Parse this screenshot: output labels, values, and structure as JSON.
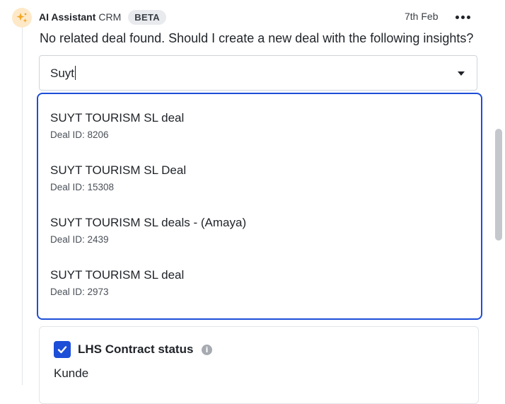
{
  "header": {
    "sender": "AI Assistant",
    "sender_suffix": "CRM",
    "badge": "BETA",
    "date": "7th Feb"
  },
  "message": "No related deal found. Should I create a new deal with the following insights?",
  "deal_select": {
    "value": "Suyt"
  },
  "deal_options": [
    {
      "title": "SUYT TOURISM SL deal",
      "subtitle": "Deal ID: 8206"
    },
    {
      "title": "SUYT TOURISM SL Deal",
      "subtitle": "Deal ID: 15308"
    },
    {
      "title": "SUYT TOURISM SL deals - (Amaya)",
      "subtitle": "Deal ID: 2439"
    },
    {
      "title": "SUYT TOURISM SL deal",
      "subtitle": "Deal ID: 2973"
    }
  ],
  "insight_card": {
    "checked": true,
    "label": "LHS Contract status",
    "value": "Kunde"
  },
  "icons": {
    "avatar": "sparkles-icon",
    "more": "more-horizontal-icon",
    "dropdown_arrow": "caret-down-icon",
    "checkbox": "checkmark-icon",
    "info": "info-icon"
  },
  "colors": {
    "accent": "#1d4ed8",
    "avatar_bg": "#fde9c8",
    "avatar_icon": "#f5a623"
  }
}
